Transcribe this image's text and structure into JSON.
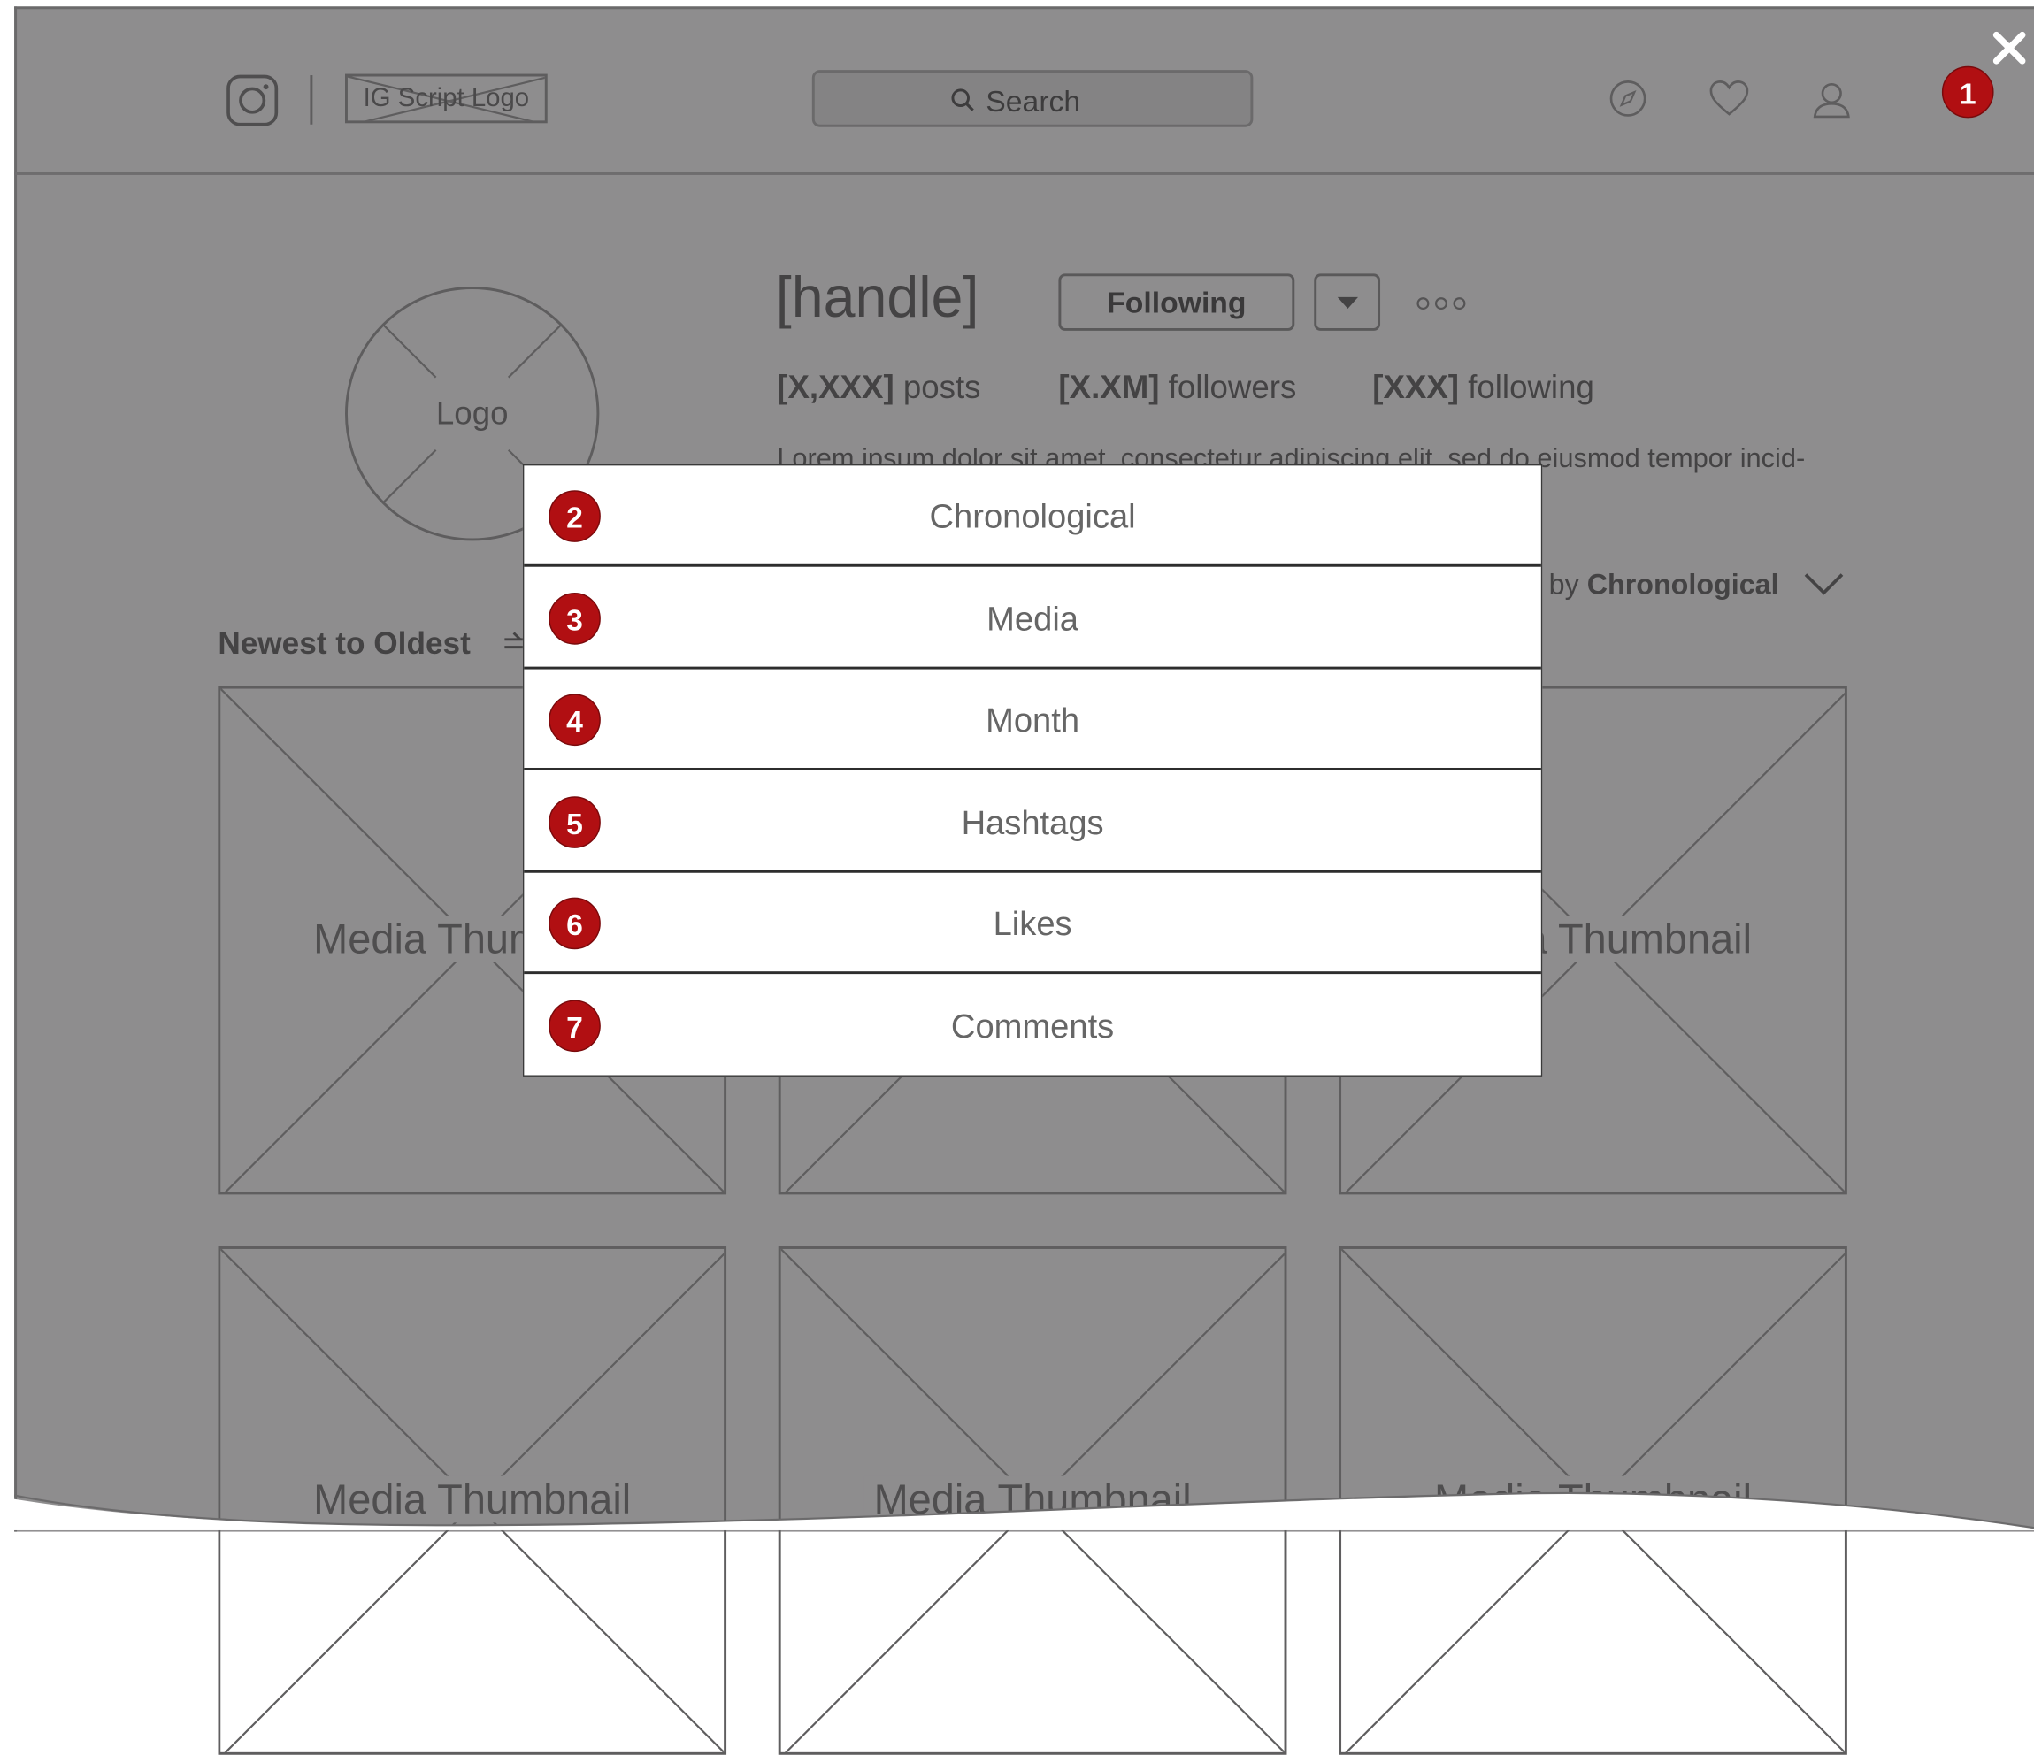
{
  "header": {
    "logo_text": "IG Script Logo",
    "search_label": "Search"
  },
  "profile": {
    "avatar_label": "Logo",
    "handle": "[handle]",
    "following_button": "Following",
    "stats": {
      "posts_value": "[X,XXX]",
      "posts_label": "posts",
      "followers_value": "[X.XM]",
      "followers_label": "followers",
      "following_value": "[XXX]",
      "following_label": "following"
    },
    "bio": "Lorem ipsum dolor sit amet, consectetur adipiscing elit, sed do eiusmod tempor incid-"
  },
  "feed": {
    "sort_order": "Newest to Oldest",
    "group_prefix": "by",
    "group_value": "Chronological",
    "thumbnail_label": "Media Thumbnail"
  },
  "menu": {
    "items": [
      {
        "badge": "2",
        "label": "Chronological"
      },
      {
        "badge": "3",
        "label": "Media"
      },
      {
        "badge": "4",
        "label": "Month"
      },
      {
        "badge": "5",
        "label": "Hashtags"
      },
      {
        "badge": "6",
        "label": "Likes"
      },
      {
        "badge": "7",
        "label": "Comments"
      }
    ]
  },
  "annotations": {
    "close_badge": "1"
  },
  "colors": {
    "overlay_gray": "#8e8d8e",
    "badge_red": "#b10f12",
    "menu_bg": "#ffffff"
  }
}
